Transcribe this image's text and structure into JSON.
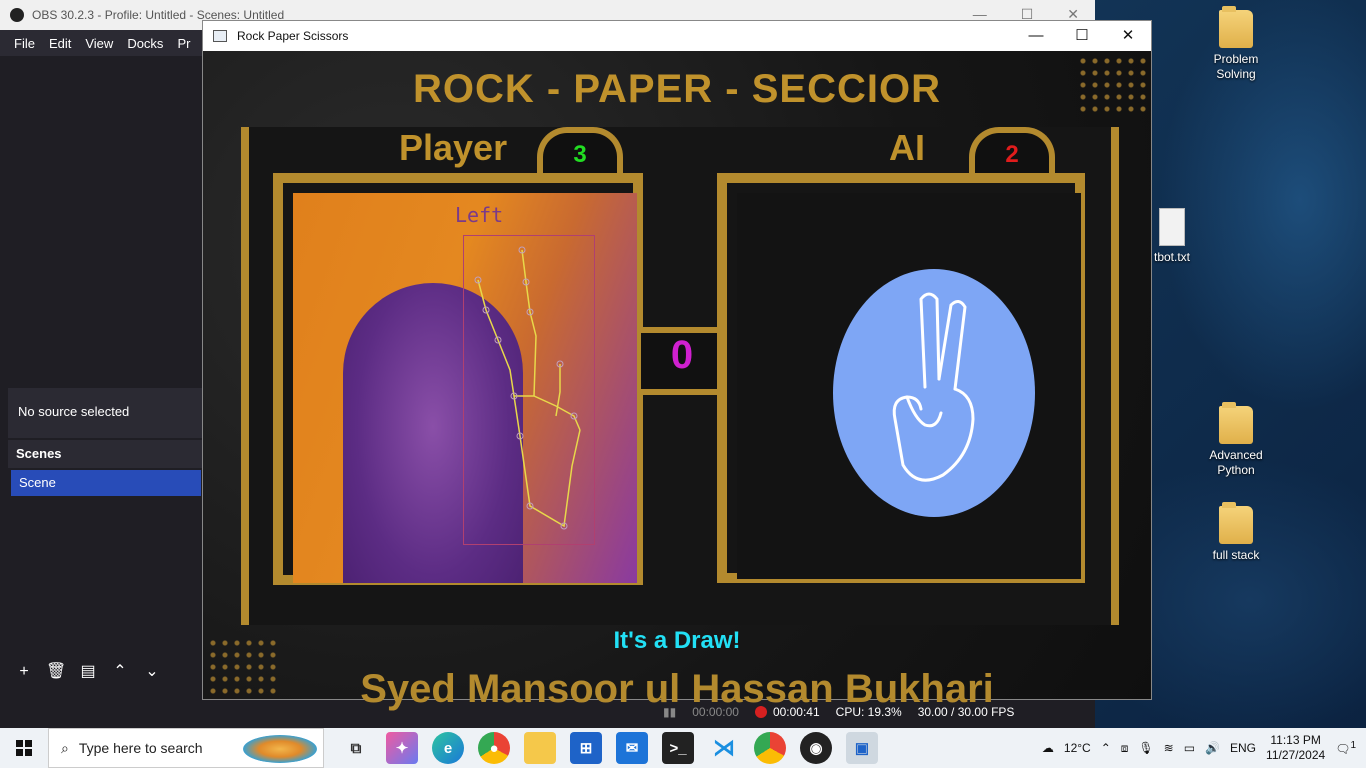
{
  "desktop": {
    "icons": [
      {
        "label_line1": "Problem",
        "label_line2": "Solving"
      },
      {
        "label_line1": "tbot.txt",
        "label_line2": ""
      },
      {
        "label_line1": "Advanced",
        "label_line2": "Python"
      },
      {
        "label_line1": "full stack",
        "label_line2": ""
      }
    ]
  },
  "obs": {
    "title": "OBS 30.2.3 - Profile: Untitled - Scenes: Untitled",
    "menu": [
      "File",
      "Edit",
      "View",
      "Docks",
      "Pr"
    ],
    "no_source": "No source selected",
    "scenes_header": "Scenes",
    "scene_item": "Scene",
    "status": {
      "stream_time": "00:00:00",
      "rec_time": "00:00:41",
      "cpu": "CPU: 19.3%",
      "fps": "30.00 / 30.00 FPS"
    }
  },
  "game": {
    "window_title": "Rock Paper Scissors",
    "heading": "ROCK - PAPER - SECCIOR",
    "player_label": "Player",
    "ai_label": "AI",
    "player_score": "3",
    "ai_score": "2",
    "center_score": "0",
    "hand_label": "Left",
    "result": "It's a Draw!",
    "author": "Syed Mansoor ul Hassan Bukhari"
  },
  "taskbar": {
    "search_placeholder": "Type here to search",
    "weather": "12°C",
    "lang": "ENG",
    "time": "11:13 PM",
    "date": "11/27/2024",
    "notifications": "1"
  },
  "colors": {
    "gold": "#b38a2e",
    "cyan": "#22e0f5",
    "magenta": "#d020d0",
    "ai_oval": "#7ea6f5",
    "obs_selected": "#284cb8"
  }
}
